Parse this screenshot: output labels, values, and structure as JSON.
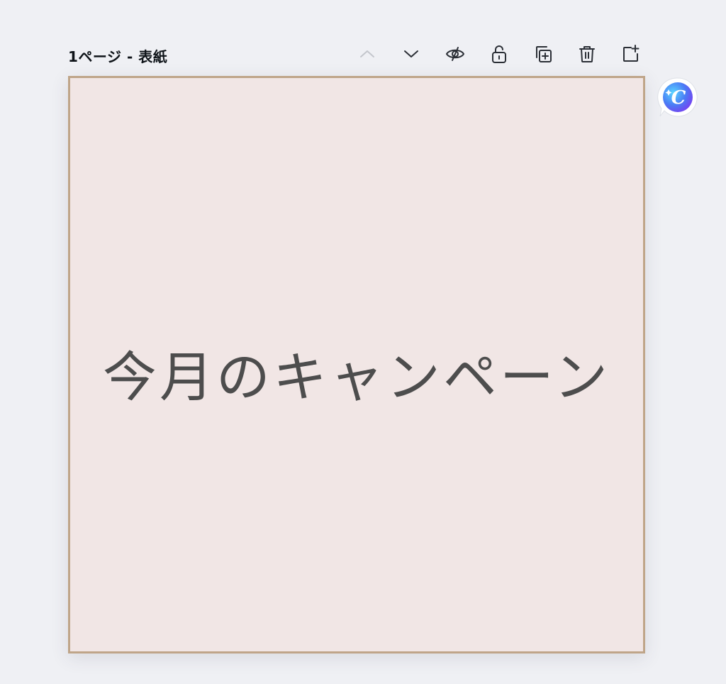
{
  "page": {
    "title": "1ページ - 表紙"
  },
  "toolbar": {
    "buttons": [
      {
        "icon": "chevron-up-icon",
        "enabled": false
      },
      {
        "icon": "chevron-down-icon",
        "enabled": true
      },
      {
        "icon": "eye-slash-icon",
        "enabled": true
      },
      {
        "icon": "unlock-icon",
        "enabled": true
      },
      {
        "icon": "duplicate-icon",
        "enabled": true
      },
      {
        "icon": "trash-icon",
        "enabled": true
      },
      {
        "icon": "add-page-icon",
        "enabled": true
      }
    ]
  },
  "canvas": {
    "text": "今月のキャンペーン",
    "background_color": "#f1e6e5",
    "border_color": "#bfa589",
    "text_color": "#4d4d4d"
  },
  "assistant": {
    "icon": "assistant-c-icon",
    "letter": "C"
  }
}
